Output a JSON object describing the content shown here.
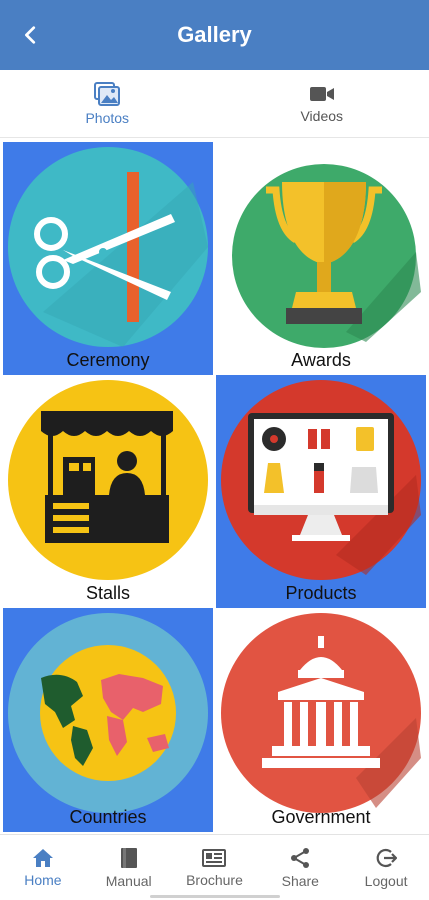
{
  "header": {
    "title": "Gallery",
    "back_icon": "chevron-left-icon"
  },
  "tabs": [
    {
      "label": "Photos",
      "icon": "photos-icon",
      "active": true
    },
    {
      "label": "Videos",
      "icon": "video-camera-icon",
      "active": false
    }
  ],
  "gallery": {
    "items": [
      {
        "label": "Ceremony",
        "icon": "ribbon-cutting-icon",
        "background": "#3f7be8"
      },
      {
        "label": "Awards",
        "icon": "trophy-icon",
        "background": "#ffffff"
      },
      {
        "label": "Stalls",
        "icon": "stall-icon",
        "background": "#ffffff"
      },
      {
        "label": "Products",
        "icon": "products-monitor-icon",
        "background": "#3f7be8"
      },
      {
        "label": "Countries",
        "icon": "world-map-icon",
        "background": "#3f7be8"
      },
      {
        "label": "Government",
        "icon": "government-building-icon",
        "background": "#ffffff"
      }
    ]
  },
  "bottom_nav": [
    {
      "label": "Home",
      "icon": "home-icon",
      "active": true
    },
    {
      "label": "Manual",
      "icon": "book-icon",
      "active": false
    },
    {
      "label": "Brochure",
      "icon": "brochure-icon",
      "active": false
    },
    {
      "label": "Share",
      "icon": "share-icon",
      "active": false
    },
    {
      "label": "Logout",
      "icon": "logout-icon",
      "active": false
    }
  ],
  "colors": {
    "primary": "#4a7fc3",
    "tile_blue": "#3f7be8"
  }
}
